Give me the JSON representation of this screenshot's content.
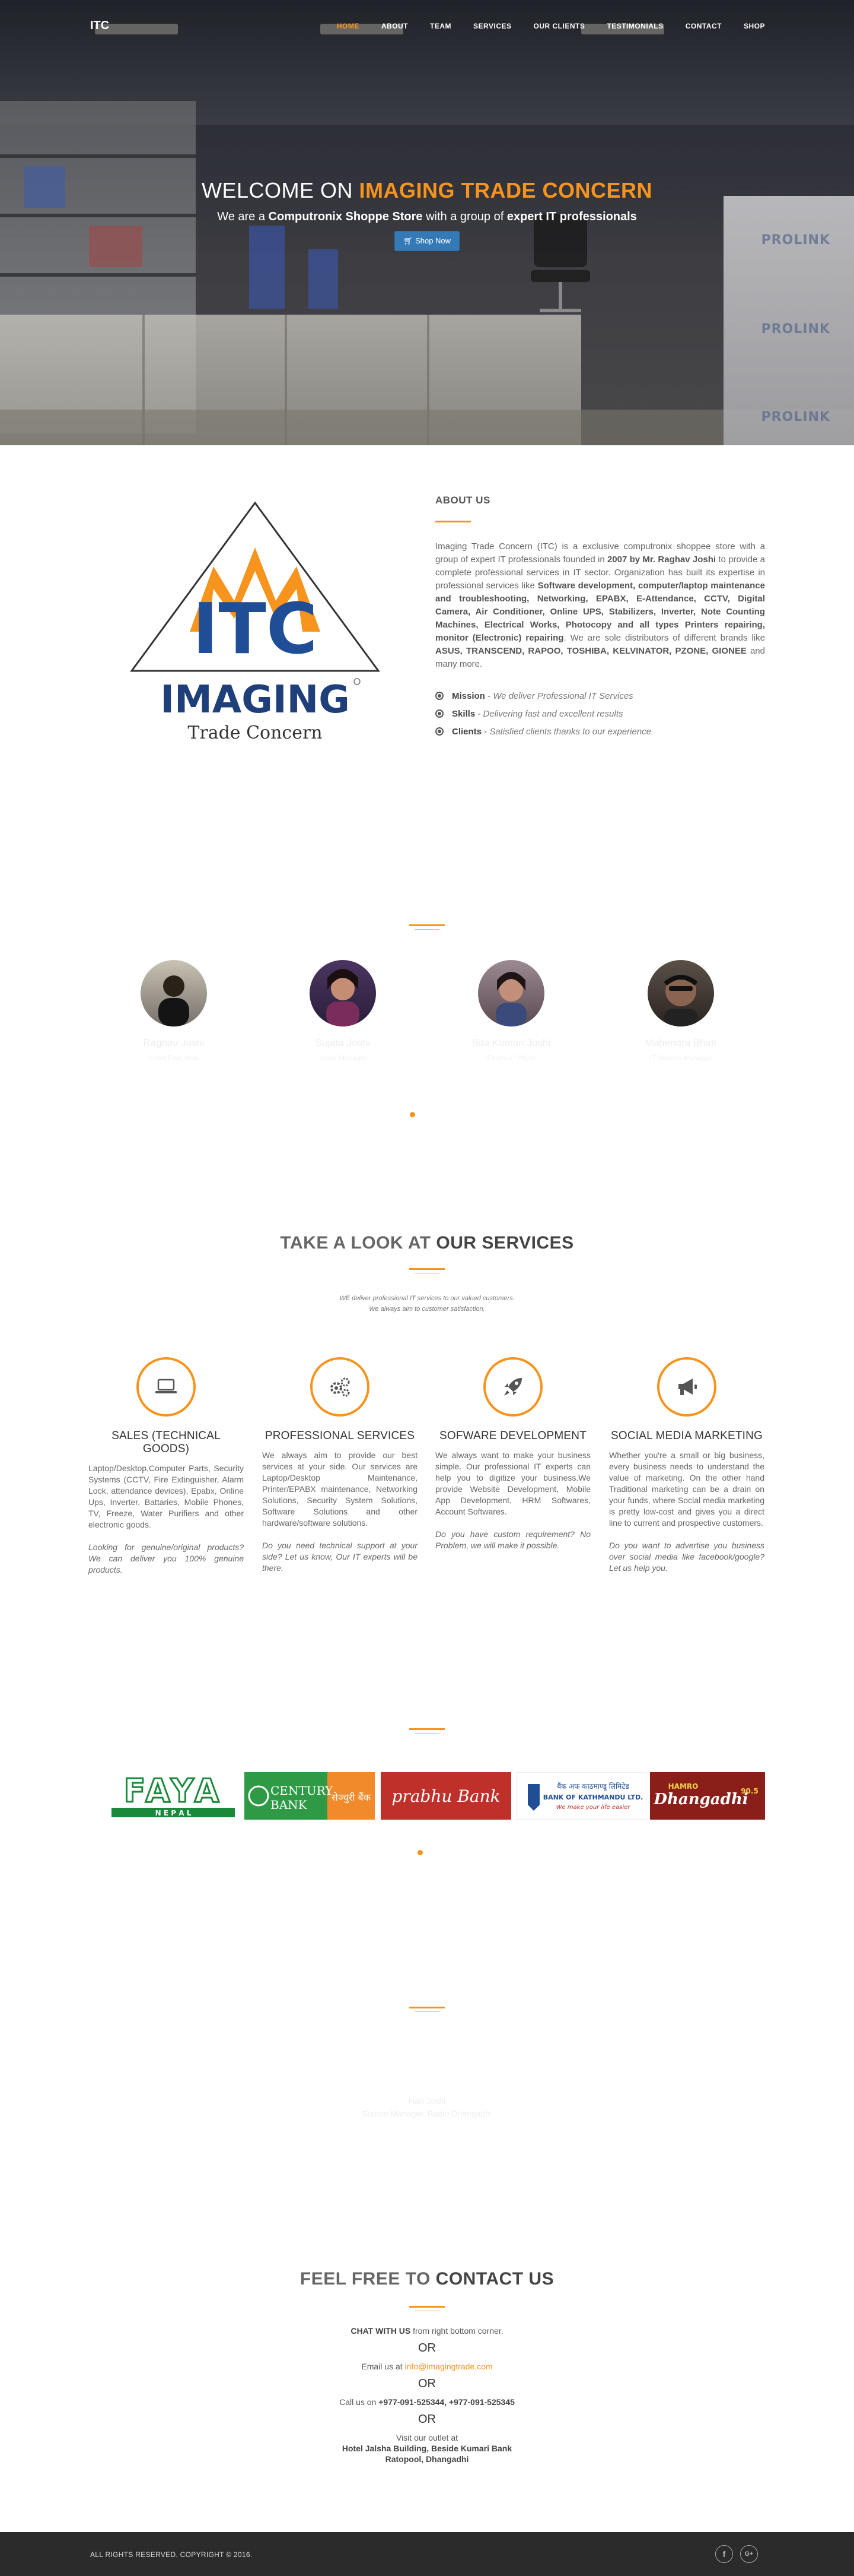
{
  "brand": "ITC",
  "nav": {
    "items": [
      "HOME",
      "ABOUT",
      "TEAM",
      "SERVICES",
      "OUR CLIENTS",
      "TESTIMONIALS",
      "CONTACT",
      "SHOP"
    ],
    "active": "HOME"
  },
  "hero": {
    "title_prefix": "WELCOME ON ",
    "title_accent": "IMAGING TRADE CONCERN",
    "sub_1": "We are a ",
    "sub_b1": "Computronix Shoppe Store",
    "sub_2": " with a group of ",
    "sub_b2": "expert IT professionals",
    "shop_button": "Shop Now",
    "background_signs": [
      "PROLINK",
      "PROLINK",
      "PROLINK"
    ]
  },
  "about": {
    "heading": "ABOUT US",
    "logo": {
      "top": "ITC",
      "word": "IMAGING",
      "sub": "Trade Concern"
    },
    "p1": "Imaging Trade Concern (ITC) is a exclusive computronix shoppee store with a group of expert IT professionals founded in ",
    "b1": "2007 by Mr. Raghav Joshi",
    "p2": " to provide a complete professional services in IT sector. Organization has built its expertise in professional services like ",
    "b2": "Software development, computer/laptop maintenance and troubleshooting, Networking, EPABX, E-Attendance, CCTV, Digital Camera, Air Conditioner, Online UPS, Stabilizers, Inverter, Note Counting Machines, Electrical Works, Photocopy and all types Printers repairing, monitor (Electronic) repairing",
    "p3": ". We are sole distributors of different brands like ",
    "b3": "ASUS, TRANSCEND, RAPOO, TOSHIBA, KELVINATOR, PZONE, GIONEE",
    "p4": " and many more.",
    "features": [
      {
        "label": "Mission",
        "text": "We deliver Professional IT Services"
      },
      {
        "label": "Skills",
        "text": "Delivering fast and excellent results"
      },
      {
        "label": "Clients",
        "text": "Satisfied clients thanks to our experience"
      }
    ]
  },
  "team": {
    "members": [
      {
        "name": "Raghav Joshi",
        "role": "Chief Executive"
      },
      {
        "name": "Sujata Joshi",
        "role": "Sales Manager"
      },
      {
        "name": "Sita Kumari Joshi",
        "role": "Finance Officer"
      },
      {
        "name": "Mahendra Bhatt",
        "role": "IT Service Manager"
      }
    ]
  },
  "services": {
    "title_light": "TAKE A LOOK AT ",
    "title_bold": "OUR SERVICES",
    "sub_1": "WE deliver professional IT services to our valued customers.",
    "sub_2": "We always aim to customer satisfaction.",
    "items": [
      {
        "icon": "laptop-icon",
        "title": "SALES (TECHNICAL GOODS)",
        "body": "Laptop/Desktop,Computer Parts, Security Systems (CCTV, Fire Extinguisher, Alarm Lock, attendance devices), Epabx, Online Ups, Inverter, Battaries, Mobile Phones, TV, Freeze, Water Purifiers and other electronic goods.",
        "note": "Looking for genuine/original products? We can deliver you 100% genuine products."
      },
      {
        "icon": "cogs-icon",
        "title": "PROFESSIONAL SERVICES",
        "body": "We always aim to provide our best services at your side. Our services are Laptop/Desktop Maintenance, Printer/EPABX maintenance, Networking Solutions, Security System Solutions, Software Solutions and other hardware/software solutions.",
        "note": "Do you need technical support at your side? Let us know, Our IT experts will be there."
      },
      {
        "icon": "rocket-icon",
        "title": "SOFWARE DEVELOPMENT",
        "body": "We always want to make your business simple. Our professional IT experts can help you to digitize your business.We provide Website Development, Mobile App Development, HRM Softwares, Account Softwares.",
        "note": "Do you have custom requirement? No Problem, we will make it possible."
      },
      {
        "icon": "bullhorn-icon",
        "title": "SOCIAL MEDIA MARKETING",
        "body": "Whether you're a small or big business, every business needs to understand the value of marketing. On the other hand Traditional marketing can be a drain on your funds, where Social media marketing is pretty low-cost and gives you a direct line to current and prospective customers.",
        "note": "Do you want to advertise you business over social media like facebook/google? Let us help you."
      }
    ]
  },
  "clients": {
    "logos": [
      {
        "name": "FAYA",
        "sub": "N E P A L"
      },
      {
        "name": "CENTURY",
        "sub": "BANK",
        "nepali": "सेञ्चुरी बैंक"
      },
      {
        "name": "prabhu Bank"
      },
      {
        "name": "BANK OF KATHMANDU LTD.",
        "nepali": "बैंक अफ काठमाण्डू लिमिटेड",
        "tag": "We make your life easier"
      },
      {
        "name": "Dhangadhi",
        "pre": "HAMRO",
        "freq": "90.5"
      }
    ]
  },
  "testimonial": {
    "name": "Hari Joshi",
    "role": "Station Manager, Radio Dhangadhi"
  },
  "contact": {
    "title_light": "FEEL FREE TO ",
    "title_bold": "CONTACT US",
    "chat_bold": "CHAT WITH US",
    "chat_rest": " from right bottom corner.",
    "or": "OR",
    "email_label": "Email us at ",
    "email": "info@imagingtrade.com",
    "call_label": "Call us on ",
    "phones": "+977-091-525344, +977-091-525345",
    "visit": "Visit our outlet at",
    "addr_1": "Hotel Jalsha Building, Beside Kumari Bank",
    "addr_2": "Ratopool, Dhangadhi"
  },
  "footer": {
    "copyright": "ALL RIGHTS RESERVED. COPYRIGHT © 2016.",
    "social": [
      "f",
      "G+"
    ]
  },
  "colors": {
    "accent": "#f7941d",
    "button": "#337ab7",
    "footer": "#2b2b2b"
  }
}
